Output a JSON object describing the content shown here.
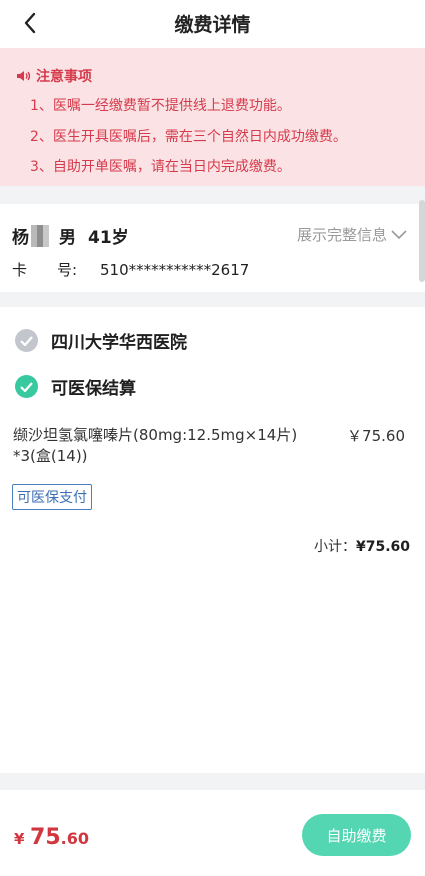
{
  "header": {
    "title": "缴费详情",
    "back_icon": "chevron-left-icon"
  },
  "notice": {
    "title": "注意事项",
    "icon": "speaker-icon",
    "color": "#d53b4c",
    "items": [
      "1、医嘱一经缴费暂不提供线上退费功能。",
      "2、医生开具医嘱后，需在三个自然日内成功缴费。",
      "3、自助开单医嘱，请在当日内完成缴费。"
    ]
  },
  "patient": {
    "surname": "杨",
    "gender": "男",
    "age": "41岁",
    "show_more": "展示完整信息",
    "card_label": "卡　　号:",
    "card_number": "510***********2617"
  },
  "order": {
    "hospital": "四川大学华西医院",
    "insurance_status": "可医保结算",
    "drug_name": "缬沙坦氢氯噻嗪片(80mg:12.5mg×14片) *3(盒(14))",
    "drug_price": "￥75.60",
    "insurance_tag": "可医保支付",
    "subtotal_label": "小计：",
    "subtotal_value": "¥75.60"
  },
  "footer": {
    "total_currency": "¥",
    "total_int": "75",
    "total_dec": ".60",
    "pay_button": "自助缴费",
    "accent": "#53d6b1"
  }
}
